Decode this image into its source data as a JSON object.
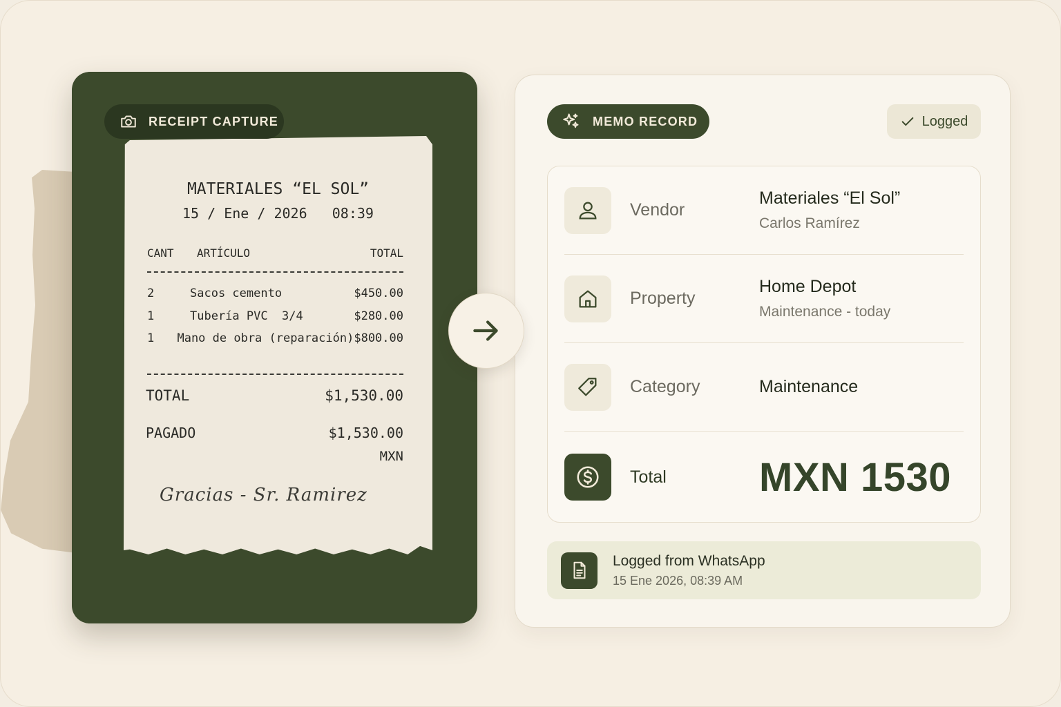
{
  "capture": {
    "badge_label": "RECEIPT CAPTURE",
    "badge_icon": "camera-icon"
  },
  "receipt": {
    "store": "MATERIALES “EL SOL”",
    "datetime": "15 / Ene / 2026   08:39",
    "columns": {
      "qty": "CANT",
      "item": "ARTÍCULO",
      "total": "TOTAL"
    },
    "items": [
      {
        "qty": "2",
        "desc": "Sacos cemento",
        "amount": "$450.00"
      },
      {
        "qty": "1",
        "desc": "Tubería PVC  3/4",
        "amount": "$280.00"
      },
      {
        "qty": "1",
        "desc": "Mano de obra (reparación)",
        "amount": "$800.00"
      }
    ],
    "total_label": "TOTAL",
    "total_value": "$1,530.00",
    "paid_label": "PAGADO",
    "paid_value": "$1,530.00",
    "currency": "MXN",
    "signature": "Gracias - Sr. Ramirez"
  },
  "transfer_icon": "arrow-right-icon",
  "memo": {
    "badge_label": "MEMO RECORD",
    "badge_icon": "sparkle-icon",
    "status": "Logged",
    "status_icon": "check-icon",
    "fields": {
      "vendor": {
        "label": "Vendor",
        "value": "Materiales “El Sol”",
        "sub": "Carlos Ramírez",
        "icon": "person-icon"
      },
      "property": {
        "label": "Property",
        "value": "Home Depot",
        "sub": "Maintenance - today",
        "icon": "house-icon"
      },
      "category": {
        "label": "Category",
        "value": "Maintenance",
        "icon": "tag-icon"
      },
      "total": {
        "label": "Total",
        "value": "MXN 1530",
        "icon": "dollar-icon"
      }
    },
    "source": {
      "title": "Logged from WhatsApp",
      "time": "15 Ene 2026, 08:39 AM",
      "icon": "document-icon"
    }
  },
  "colors": {
    "accent": "#3c4a2c",
    "background": "#f6efe3",
    "card": "#f9f5ed",
    "receipt_paper": "#efe9dd"
  }
}
